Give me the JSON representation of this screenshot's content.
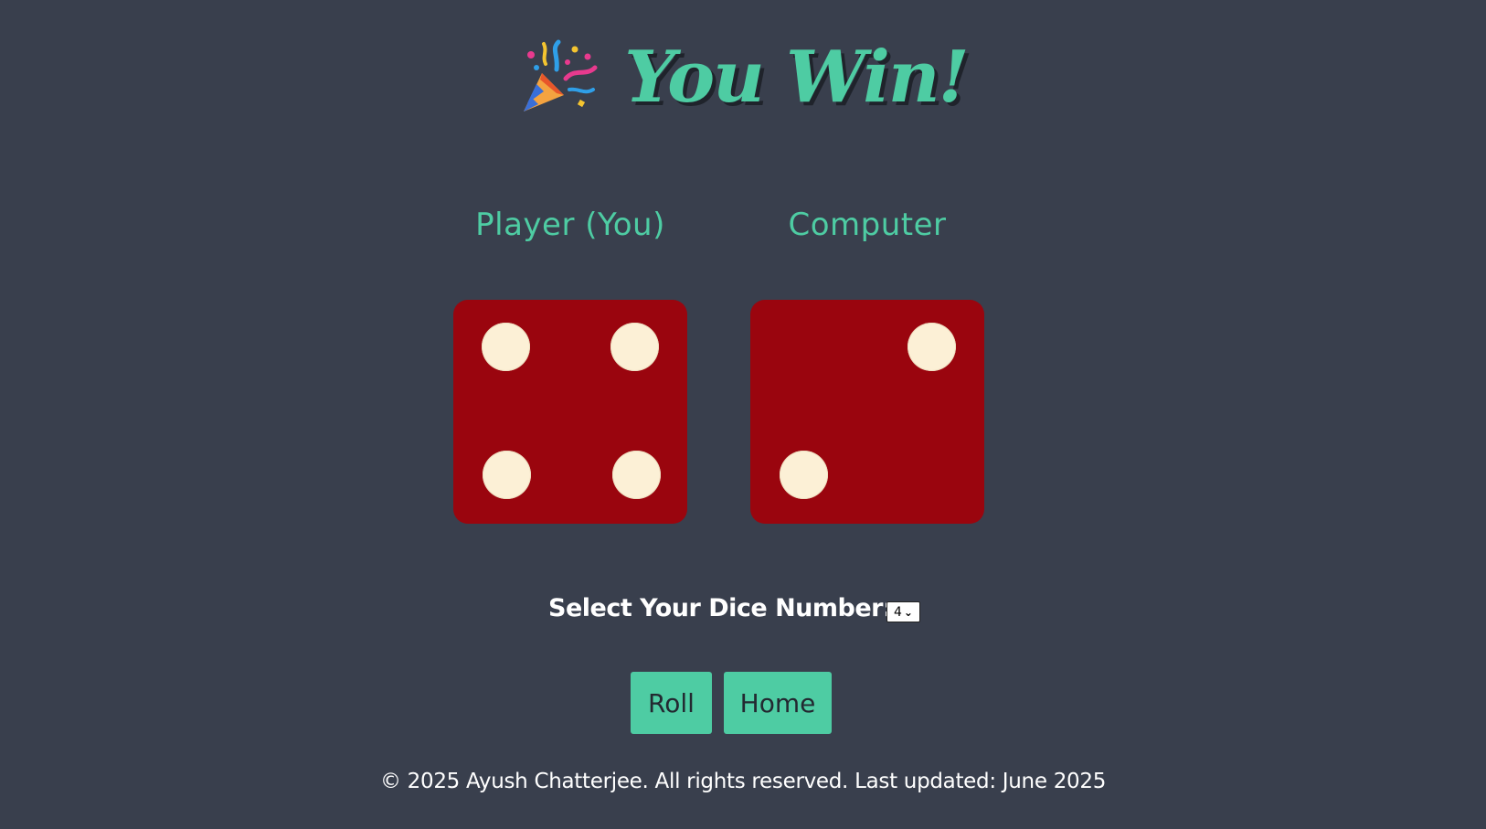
{
  "header": {
    "title": "You Win!",
    "title_icon": "party-popper-icon"
  },
  "players": {
    "player_label": "Player (You)",
    "computer_label": "Computer"
  },
  "dice": {
    "player_value": 4,
    "computer_value": 2,
    "die_color": "#9a050e",
    "pip_color": "#fcf0d6"
  },
  "controls": {
    "select_label": "Select Your Dice Number:",
    "selected_number": "4",
    "roll_label": "Roll",
    "home_label": "Home"
  },
  "footer": {
    "text": "© 2025 Ayush Chatterjee. All rights reserved. Last updated: June 2025"
  },
  "colors": {
    "background": "#393f4d",
    "accent": "#4ecca3"
  }
}
